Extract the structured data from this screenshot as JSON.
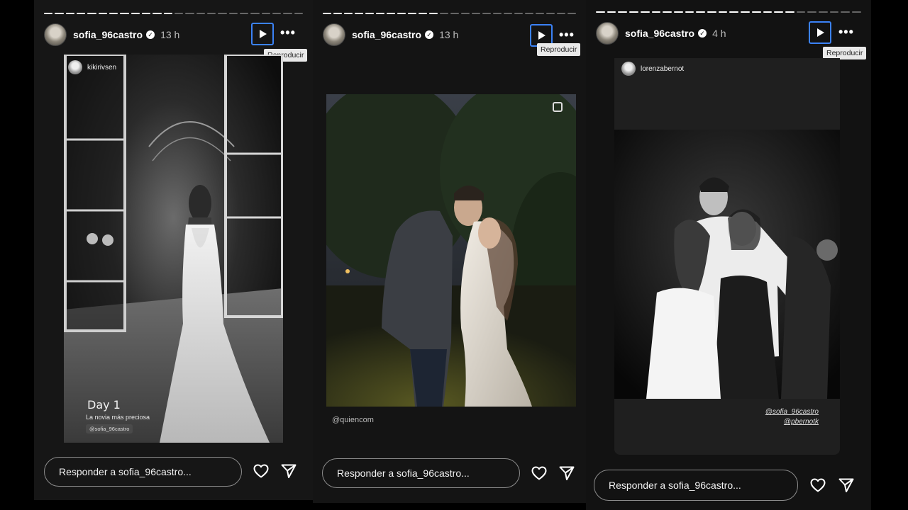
{
  "stories": [
    {
      "username": "sofia_96castro",
      "time": "13 h",
      "play_tooltip": "Reproducir",
      "tagged_user": "kikirivsen",
      "caption_title": "Day 1",
      "caption_subtitle": "La novia más preciosa",
      "mention": "@sofia_96castro",
      "reply_placeholder": "Responder a sofia_96castro...",
      "progress": {
        "total": 24,
        "filled": 12
      }
    },
    {
      "username": "sofia_96castro",
      "time": "13 h",
      "play_tooltip": "Reproducir",
      "source_credit": "@quiencom",
      "reply_placeholder": "Responder a sofia_96castro...",
      "progress": {
        "total": 24,
        "filled": 11
      }
    },
    {
      "username": "sofia_96castro",
      "time": "4 h",
      "play_tooltip": "Reproducir",
      "tagged_user": "lorenzabernot",
      "mention_1": "@sofia_96castro",
      "mention_2": "@pbernotk",
      "reply_placeholder": "Responder a sofia_96castro...",
      "progress": {
        "total": 24,
        "filled": 18
      }
    }
  ],
  "colors": {
    "accent": "#3b82f6",
    "panel": "#151515"
  },
  "icons": [
    "play-icon",
    "more-icon",
    "heart-icon",
    "send-icon",
    "verified-icon",
    "multi-photo-icon"
  ]
}
